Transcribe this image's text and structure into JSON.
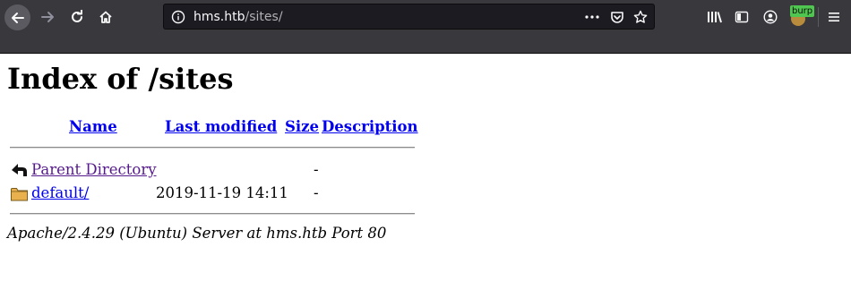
{
  "browser": {
    "url_host": "hms.htb",
    "url_path": "/sites/",
    "extension_badge": "burp",
    "icons": {
      "back": "back-arrow-icon",
      "forward": "forward-arrow-icon",
      "reload": "reload-icon",
      "home": "home-icon",
      "site_info": "info-circle-icon",
      "page_actions": "more-dots-icon",
      "pocket": "pocket-icon",
      "bookmark": "star-icon",
      "library": "library-icon",
      "sidebar": "sidebar-icon",
      "account": "account-icon",
      "menu": "hamburger-menu-icon"
    }
  },
  "page": {
    "title": "Index of /sites",
    "columns": {
      "name": "Name",
      "last_modified": "Last modified",
      "size": "Size",
      "description": "Description"
    },
    "rows": [
      {
        "icon": "parent-directory-icon",
        "name": "Parent Directory",
        "modified": "",
        "size": "-",
        "visited": true
      },
      {
        "icon": "folder-icon",
        "name": "default/",
        "modified": "2019-11-19 14:11",
        "size": "-",
        "visited": false
      }
    ],
    "address": "Apache/2.4.29 (Ubuntu) Server at hms.htb Port 80"
  },
  "colors": {
    "toolbar_bg": "#38383d",
    "urlbar_bg": "#1c1b22",
    "link": "#0000ee",
    "visited_link": "#551a8b",
    "burp_badge": "#4fc64f"
  }
}
